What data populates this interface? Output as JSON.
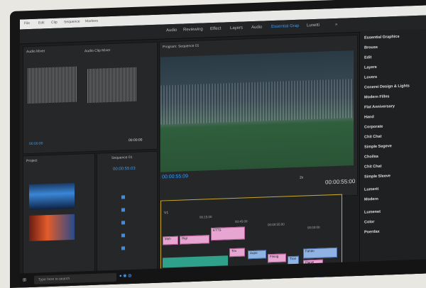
{
  "menubar": {
    "items": [
      "File",
      "Edit",
      "Clip",
      "Sequence",
      "Markers"
    ]
  },
  "workspaces": {
    "tabs": [
      "Audio",
      "Reviewing",
      "Effect",
      "Layers",
      "Audio",
      "Essential Grap",
      "Lunetti"
    ],
    "active_index": 5
  },
  "source_panel": {
    "title": "Audio Mixer",
    "clip_title": "Audio Clip Mixer",
    "timecode_blue": "00:00:00",
    "timecode_right": "00:00:00"
  },
  "program_monitor": {
    "title": "Program: Sequence 01",
    "timecode": "00:00:55:09",
    "zoom": "2x",
    "duration": "00:00:55:00"
  },
  "essential_graphics": {
    "items": [
      "Essential Graphics",
      "Brouss",
      "Edit",
      "Layers",
      "Lovers",
      "Conerei Design & Lights",
      "Modern Filles",
      "Flat Anniversary",
      "Hand",
      "Corporate",
      "Chit Chat",
      "Simple Segeve",
      "Choilsa",
      "Chit Chat",
      "Simple Sleeve",
      "Lumerit",
      "Modern",
      "Lumenet",
      "Color",
      "Poerdax"
    ]
  },
  "project_panel": {
    "title": "Project",
    "sequence_title": "Sequence 01",
    "timecode": "00:00:55:03"
  },
  "timeline": {
    "label": "V1",
    "ruler": [
      "00:15:00",
      "00:45:00",
      "00:00:55:00",
      "00:03:00"
    ],
    "clips": [
      "Moh",
      "Rigl",
      "ETTS",
      "Tox",
      "Aupo",
      "Flinog",
      "Tron",
      "Flanel",
      "Voobe",
      "Fahdo"
    ]
  },
  "taskbar": {
    "search_placeholder": "Type here to search"
  },
  "colors": {
    "accent": "#3a9cf2",
    "clip_pink": "#e7a6d2",
    "clip_blue": "#8fb3e3",
    "audio_teal": "#2fa08a"
  }
}
